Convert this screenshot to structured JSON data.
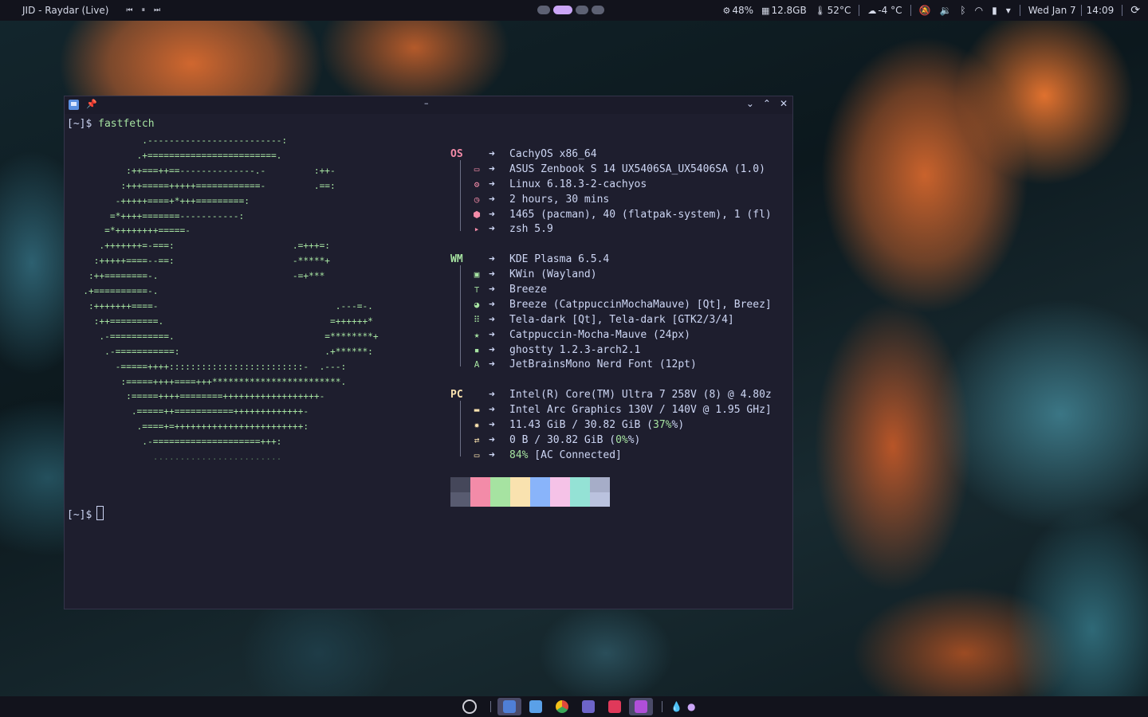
{
  "topbar": {
    "media_title": "JID - Raydar (Live)",
    "media_prev": "⏮",
    "media_play": "⏸",
    "media_next": "⏭",
    "stats": [
      {
        "icon": "cpu-icon",
        "glyph": "⚙",
        "value": "48%"
      },
      {
        "icon": "ram-icon",
        "glyph": "▦",
        "value": "12.8GB"
      },
      {
        "icon": "thermometer-icon",
        "glyph": "🌡",
        "value": "52°C"
      },
      {
        "icon": "weather-icon",
        "glyph": "☁",
        "value": "-4 °C"
      }
    ],
    "date": "Wed Jan 7",
    "time": "14:09"
  },
  "terminal": {
    "title": "–",
    "prompt": "[~]$",
    "command": "fastfetch",
    "logo_lines": [
      "              .-------------------------:",
      "             .+========================.",
      "           :++===++==--------------.-         :++-",
      "          :+++=====+++++============-         .==:",
      "         -+++++====+*+++=========:",
      "        =*++++=======-----------:",
      "       =*++++++++=====-",
      "      .+++++++=-===:                      .=+++=:",
      "     :+++++====--==:                      -*****+",
      "    :++========-.                         -=+***",
      "   .+==========-.",
      "    :+++++++====-                                 .---=-.",
      "     :++=========.                               =++++++*",
      "      .-===========.                            =********+",
      "       .-===========:                           .+******:",
      "         -=====++++:::::::::::::::::::::::::-  .---:",
      "          :=====++++====+++************************.",
      "           :=====++++========++++++++++++++++++-",
      "            .=====++===========+++++++++++++-",
      "             .====+=++++++++++++++++++++++++:",
      "              .-====================+++:",
      "                ........................"
    ],
    "sections": [
      {
        "label": "OS",
        "color": "#f38ba8",
        "rows": [
          {
            "icon": "os-icon",
            "glyph": "",
            "value": "CachyOS x86_64"
          },
          {
            "icon": "laptop-icon",
            "glyph": "▭",
            "value": "ASUS Zenbook S 14 UX5406SA_UX5406SA (1.0)"
          },
          {
            "icon": "kernel-gear-icon",
            "glyph": "⚙",
            "value": "Linux 6.18.3-2-cachyos"
          },
          {
            "icon": "clock-icon",
            "glyph": "◷",
            "value": "2 hours, 30 mins"
          },
          {
            "icon": "package-icon",
            "glyph": "⬢",
            "value": "1465 (pacman), 40 (flatpak-system), 1 (fl)"
          },
          {
            "icon": "shell-icon",
            "glyph": "▸",
            "value": "zsh 5.9"
          }
        ]
      },
      {
        "label": "WM",
        "color": "#a6e3a1",
        "rows": [
          {
            "icon": "desktop-icon",
            "glyph": "",
            "value": "KDE Plasma 6.5.4"
          },
          {
            "icon": "window-icon",
            "glyph": "▣",
            "value": "KWin (Wayland)"
          },
          {
            "icon": "paint-roller-icon",
            "glyph": "⊤",
            "value": "Breeze"
          },
          {
            "icon": "palette-icon",
            "glyph": "◕",
            "value": "Breeze (CatppuccinMochaMauve) [Qt], Breez]"
          },
          {
            "icon": "grid-icon",
            "glyph": "⠿",
            "value": "Tela-dark [Qt], Tela-dark [GTK2/3/4]"
          },
          {
            "icon": "star-icon",
            "glyph": "★",
            "value": "Catppuccin-Mocha-Mauve (24px)"
          },
          {
            "icon": "terminal-icon",
            "glyph": "▪",
            "value": "ghostty 1.2.3-arch2.1"
          },
          {
            "icon": "font-icon",
            "glyph": "A",
            "value": "JetBrainsMono Nerd Font (12pt)"
          }
        ]
      },
      {
        "label": "PC",
        "color": "#f9e2af",
        "rows": [
          {
            "icon": "cpu-chip-icon",
            "glyph": "",
            "value": "Intel(R) Core(TM) Ultra 7 258V (8) @ 4.80z"
          },
          {
            "icon": "gpu-icon",
            "glyph": "▬",
            "value": "Intel Arc Graphics 130V / 140V @ 1.95 GHz]"
          },
          {
            "icon": "memory-icon",
            "glyph": "✹",
            "value_pre": "11.43 GiB / 30.82 GiB (",
            "value_hl": "37%",
            "value_post": "%)"
          },
          {
            "icon": "swap-icon",
            "glyph": "⇄",
            "value_pre": "0 B / 30.82 GiB (",
            "value_hl": "0%",
            "value_post": "%)"
          },
          {
            "icon": "battery-icon",
            "glyph": "▭",
            "value_pre": "",
            "value_hl": "84%",
            "value_post": " [AC Connected]"
          }
        ]
      }
    ],
    "arrow": "➜",
    "palette": [
      {
        "top": "#45475a",
        "bottom": "#585b70"
      },
      {
        "top": "#f38ba8",
        "bottom": "#f38ba8"
      },
      {
        "top": "#a6e3a1",
        "bottom": "#a6e3a1"
      },
      {
        "top": "#f9e2af",
        "bottom": "#f9e2af"
      },
      {
        "top": "#89b4fa",
        "bottom": "#89b4fa"
      },
      {
        "top": "#f5c2e7",
        "bottom": "#f5c2e7"
      },
      {
        "top": "#94e2d5",
        "bottom": "#94e2d5"
      },
      {
        "top": "#a6adc8",
        "bottom": "#bac2de"
      }
    ]
  },
  "taskbar": {
    "apps": [
      {
        "name": "launcher-icon",
        "color": "#d0d0d8",
        "active": false
      },
      {
        "name": "konsole-app-icon",
        "color": "#4f7fd6",
        "active": true
      },
      {
        "name": "files-app-icon",
        "color": "#5aa0e8",
        "active": false
      },
      {
        "name": "chrome-app-icon",
        "color": "#e8b62f",
        "active": false
      },
      {
        "name": "teams-app-icon",
        "color": "#6d64c8",
        "active": false
      },
      {
        "name": "screenshot-app-icon",
        "color": "#e0395a",
        "active": false
      },
      {
        "name": "spectacle-app-icon",
        "color": "#b04fd8",
        "active": true
      }
    ],
    "tray": [
      "💧",
      "●"
    ]
  }
}
